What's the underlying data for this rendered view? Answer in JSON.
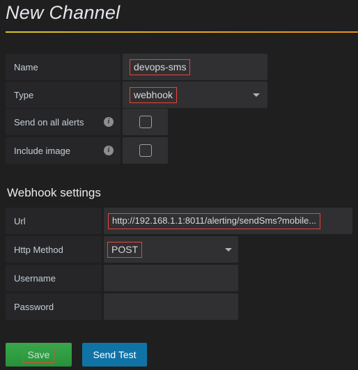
{
  "page": {
    "title": "New Channel",
    "accent_left": "#d8c427",
    "accent_right": "#eb9017",
    "highlight_color": "#e8453c"
  },
  "channel_form": {
    "rows": [
      {
        "label": "Name",
        "value": "devops-sms",
        "kind": "text",
        "highlighted": true
      },
      {
        "label": "Type",
        "value": "webhook",
        "kind": "select",
        "highlighted": true
      },
      {
        "label": "Send on all alerts",
        "value": "",
        "kind": "checkbox",
        "info": "i",
        "checked": false
      },
      {
        "label": "Include image",
        "value": "",
        "kind": "checkbox",
        "info": "i",
        "checked": false
      }
    ]
  },
  "webhook_section": {
    "heading": "Webhook settings",
    "rows": [
      {
        "label": "Url",
        "value": "http://192.168.1.1:8011/alerting/sendSms?mobile...",
        "kind": "text",
        "highlighted": true
      },
      {
        "label": "Http Method",
        "value": "POST",
        "kind": "select",
        "highlighted": true
      },
      {
        "label": "Username",
        "value": "",
        "kind": "text",
        "highlighted": false
      },
      {
        "label": "Password",
        "value": "",
        "kind": "text",
        "highlighted": false
      }
    ]
  },
  "actions": {
    "save_label": "Save",
    "send_test_label": "Send Test",
    "save_color": "#2f9e41",
    "send_test_color": "#1073a6"
  }
}
